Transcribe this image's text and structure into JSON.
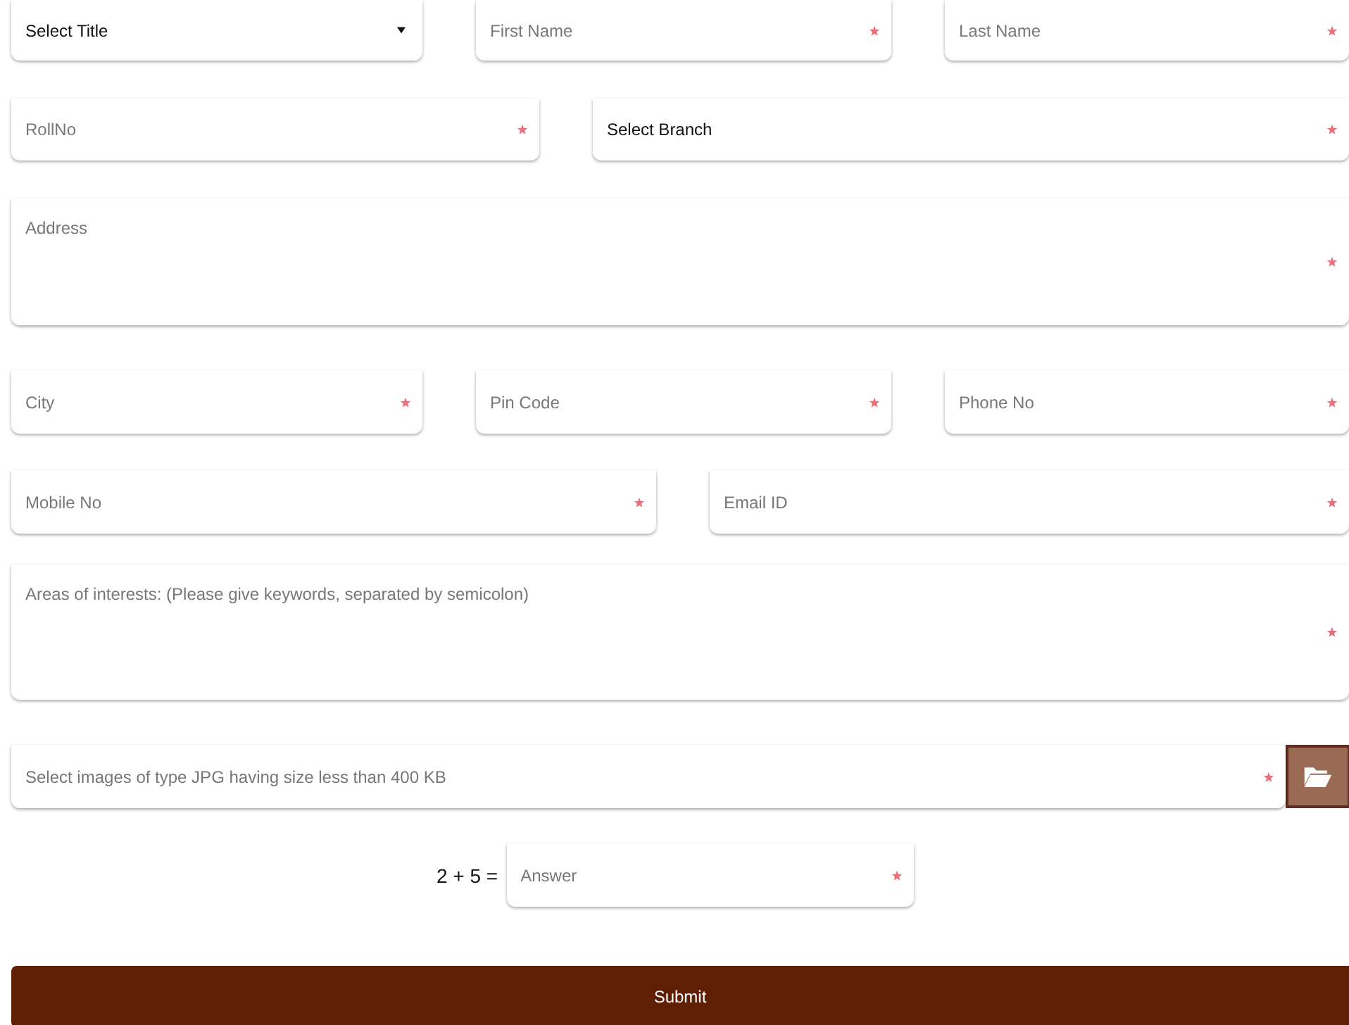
{
  "rows": [
    {
      "fields": [
        {
          "kind": "select",
          "value": "Select Title",
          "required": false,
          "caret": true
        },
        {
          "kind": "text",
          "placeholder": "First Name",
          "required": true
        },
        {
          "kind": "text",
          "placeholder": "Last Name",
          "required": true
        }
      ]
    },
    {
      "fields": [
        {
          "kind": "text",
          "placeholder": "RollNo",
          "required": true
        },
        {
          "kind": "select",
          "value": "Select Branch",
          "required": true,
          "caret": false
        }
      ]
    },
    {
      "fields": [
        {
          "kind": "textarea",
          "placeholder": "Address",
          "required": true
        }
      ]
    },
    {
      "fields": [
        {
          "kind": "text",
          "placeholder": "City",
          "required": true
        },
        {
          "kind": "text",
          "placeholder": "Pin Code",
          "required": true
        },
        {
          "kind": "text",
          "placeholder": "Phone No",
          "required": true
        }
      ]
    },
    {
      "fields": [
        {
          "kind": "text",
          "placeholder": "Mobile No",
          "required": true
        },
        {
          "kind": "text",
          "placeholder": "Email ID",
          "required": true
        }
      ]
    },
    {
      "fields": [
        {
          "kind": "textarea",
          "placeholder": "Areas of interests: (Please give keywords, separated by semicolon)",
          "required": true
        }
      ]
    },
    {
      "fields": [
        {
          "kind": "file",
          "placeholder": "Select images of type JPG having size less than 400 KB",
          "required": true
        }
      ]
    }
  ],
  "captcha": {
    "question": "2 + 5 =",
    "placeholder": "Answer",
    "required": true
  },
  "submit": "Submit"
}
